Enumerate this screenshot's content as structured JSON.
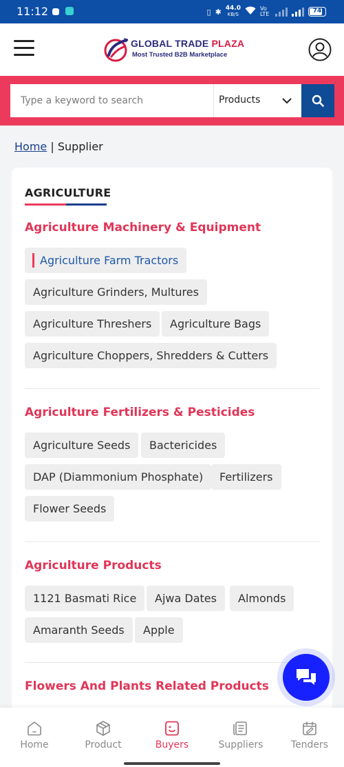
{
  "status_bar": {
    "time": "11:12",
    "net_speed": "44.0",
    "net_unit": "KB/S",
    "volte": "Vo LTE",
    "battery": "74"
  },
  "header": {
    "logo_title_part1": "GLOBAL TRADE",
    "logo_title_part2": "PLAZA",
    "logo_subtitle": "Most Trusted B2B Marketplace",
    "menu_icon": "hamburger-menu-icon",
    "profile_icon": "user-circle-icon"
  },
  "search": {
    "placeholder": "Type a keyword to search",
    "category_selected": "Products",
    "button_icon": "search-icon"
  },
  "breadcrumb": {
    "home": "Home",
    "separator": " | ",
    "current": "Supplier"
  },
  "category": {
    "title": "AGRICULTURE",
    "sections": [
      {
        "title": "Agriculture Machinery & Equipment",
        "items": [
          "Agriculture Farm Tractors",
          "Agriculture Grinders, Multures",
          "Agriculture Threshers",
          "Agriculture Bags",
          "Agriculture Choppers, Shredders & Cutters"
        ]
      },
      {
        "title": "Agriculture Fertilizers & Pesticides",
        "items": [
          "Agriculture Seeds",
          "Bactericides",
          "DAP (Diammonium Phosphate)",
          "Fertilizers",
          "Flower Seeds"
        ]
      },
      {
        "title": "Agriculture Products",
        "items": [
          "1121 Basmati Rice",
          "Ajwa Dates",
          "Almonds",
          "Amaranth Seeds",
          "Apple"
        ]
      },
      {
        "title": "Flowers And Plants Related Products",
        "items": []
      }
    ]
  },
  "chat_fab": {
    "icon": "chat-icon"
  },
  "bottom_nav": [
    {
      "label": "Home",
      "icon": "home-icon",
      "active": false
    },
    {
      "label": "Product",
      "icon": "cube-icon",
      "active": false
    },
    {
      "label": "Buyers",
      "icon": "buyers-icon",
      "active": true
    },
    {
      "label": "Suppliers",
      "icon": "suppliers-icon",
      "active": false
    },
    {
      "label": "Tenders",
      "icon": "tenders-icon",
      "active": false
    }
  ],
  "colors": {
    "status_bar": "#0d4ea6",
    "search_band": "#ec3a5d",
    "search_button": "#104b95",
    "section_title": "#e03658",
    "active_chip_text": "#1e58a8",
    "fab": "#1721ff"
  }
}
